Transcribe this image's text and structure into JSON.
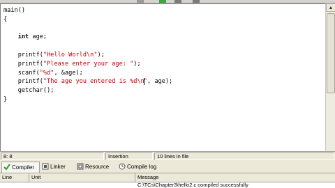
{
  "editor": {
    "lines": [
      [
        "main()"
      ],
      [
        "{"
      ],
      [
        ""
      ],
      [
        "    ",
        {
          "kw": "int"
        },
        " age;"
      ],
      [
        ""
      ],
      [
        "    printf(",
        {
          "str": "\"Hello World\\n\""
        },
        ");"
      ],
      [
        "    printf(",
        {
          "str": "\"Please enter your age: \""
        },
        ");"
      ],
      [
        "    scanf(",
        {
          "str": "\"%d\""
        },
        ", &age);"
      ],
      [
        "    printf(",
        {
          "str": "\"The age you entered is %d\\n"
        },
        {
          "cursor": true
        },
        {
          "str": "\""
        },
        ", age);"
      ],
      [
        "    getchar();"
      ],
      [
        "}"
      ]
    ]
  },
  "status": {
    "position": "8: 8",
    "mode": "Insertion",
    "line_count": "10 lines in file"
  },
  "tabs": [
    {
      "label": "Compiler",
      "icon": "check-icon",
      "active": true
    },
    {
      "label": "Linker",
      "icon": "linker-icon",
      "active": false
    },
    {
      "label": "Resource",
      "icon": "resource-icon",
      "active": false
    },
    {
      "label": "Compile log",
      "icon": "compile-log-icon",
      "active": false
    }
  ],
  "messages": {
    "columns": [
      "Line",
      "Unit",
      "Message"
    ],
    "rows": [
      {
        "line": "",
        "unit": "",
        "message": "C:\\TCs\\Chapter3\\hello2.c compiled successfully"
      }
    ]
  },
  "colors": {
    "string": "#c00000",
    "panel": "#ece9d8",
    "check": "#2e9b2e"
  }
}
